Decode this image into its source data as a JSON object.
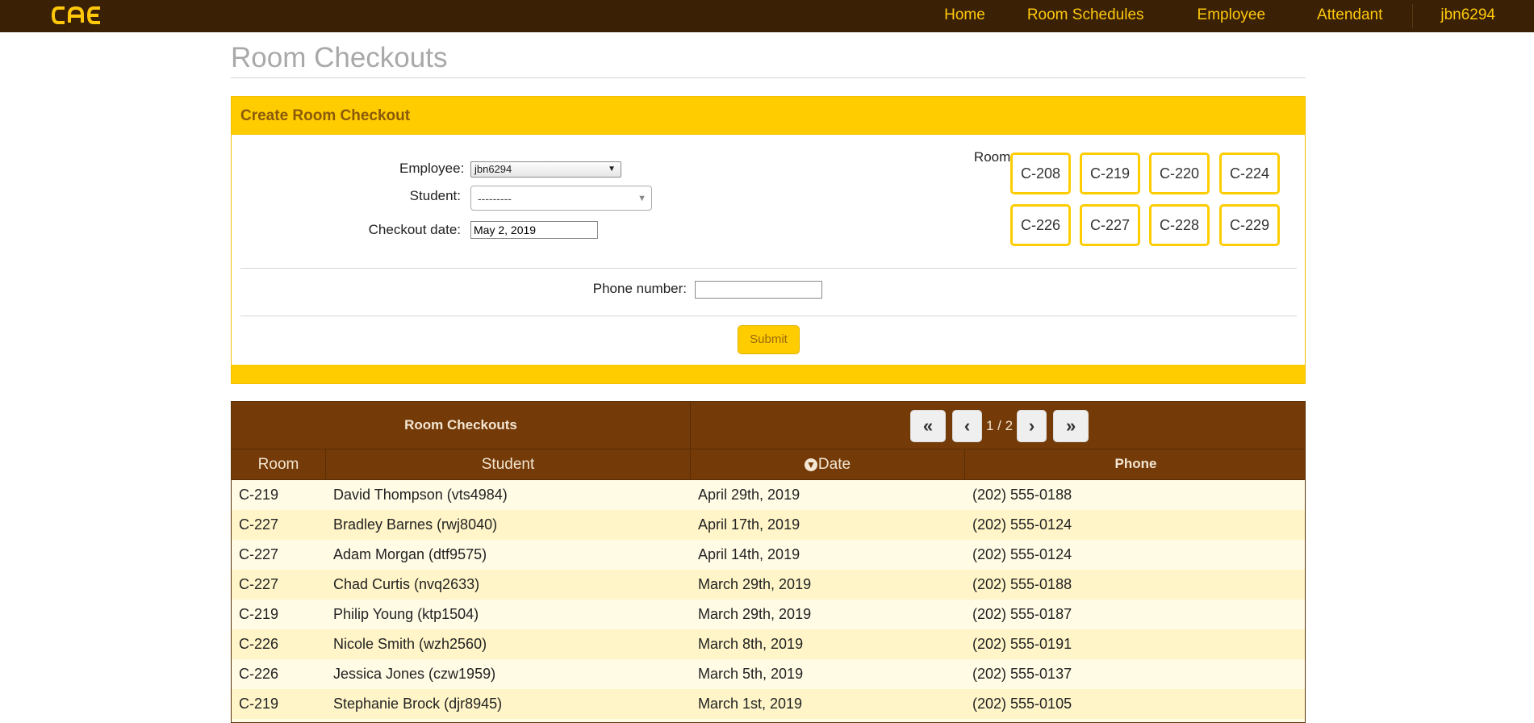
{
  "nav": {
    "logo_text": "cae",
    "links": [
      "Home",
      "Room Schedules",
      "Employee",
      "Attendant"
    ],
    "user": "jbn6294"
  },
  "page_title": "Room Checkouts",
  "form": {
    "panel_title": "Create Room Checkout",
    "employee_label": "Employee:",
    "employee_value": "jbn6294",
    "student_label": "Student:",
    "student_value": "---------",
    "date_label": "Checkout date:",
    "date_value": "May 2, 2019",
    "room_label": "Room:",
    "rooms": [
      "C-208",
      "C-219",
      "C-220",
      "C-224",
      "C-226",
      "C-227",
      "C-228",
      "C-229"
    ],
    "phone_label": "Phone number:",
    "phone_value": "",
    "submit_label": "Submit"
  },
  "table": {
    "title": "Room Checkouts",
    "pager": {
      "first": "«",
      "prev": "‹",
      "info": "1 / 2",
      "next": "›",
      "last": "»"
    },
    "columns": {
      "room": "Room",
      "student": "Student",
      "date": "Date",
      "phone": "Phone"
    },
    "rows": [
      {
        "room": "C-219",
        "student": "David Thompson (vts4984)",
        "date": "April 29th, 2019",
        "phone": "(202) 555-0188"
      },
      {
        "room": "C-227",
        "student": "Bradley Barnes (rwj8040)",
        "date": "April 17th, 2019",
        "phone": "(202) 555-0124"
      },
      {
        "room": "C-227",
        "student": "Adam Morgan (dtf9575)",
        "date": "April 14th, 2019",
        "phone": "(202) 555-0124"
      },
      {
        "room": "C-227",
        "student": "Chad Curtis (nvq2633)",
        "date": "March 29th, 2019",
        "phone": "(202) 555-0188"
      },
      {
        "room": "C-219",
        "student": "Philip Young (ktp1504)",
        "date": "March 29th, 2019",
        "phone": "(202) 555-0187"
      },
      {
        "room": "C-226",
        "student": "Nicole Smith (wzh2560)",
        "date": "March 8th, 2019",
        "phone": "(202) 555-0191"
      },
      {
        "room": "C-226",
        "student": "Jessica Jones (czw1959)",
        "date": "March 5th, 2019",
        "phone": "(202) 555-0137"
      },
      {
        "room": "C-219",
        "student": "Stephanie Brock (djr8945)",
        "date": "March 1st, 2019",
        "phone": "(202) 555-0105"
      }
    ]
  },
  "colors": {
    "navbar": "#3a2106",
    "accent": "#ffcc00",
    "table_header": "#743a07",
    "row_odd": "#fffbe5",
    "row_even": "#fff5c8"
  }
}
